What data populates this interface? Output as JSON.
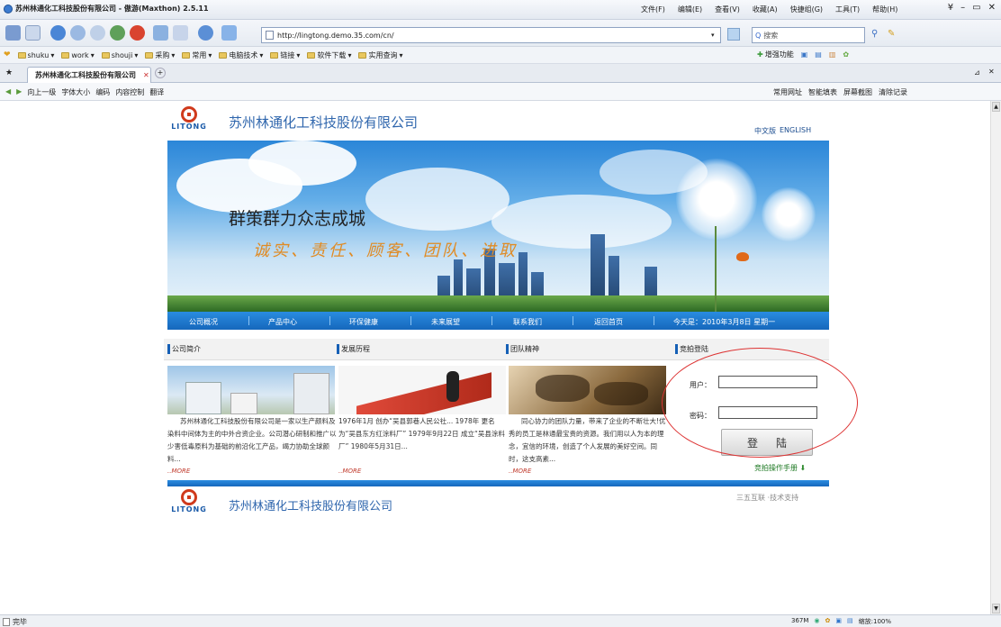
{
  "browser": {
    "window_title": "苏州林通化工科技股份有限公司 - 傲游(Maxthon) 2.5.11",
    "menus": [
      "文件(F)",
      "编辑(E)",
      "查看(V)",
      "收藏(A)",
      "快捷组(G)",
      "工具(T)",
      "帮助(H)"
    ],
    "address": "http://lingtong.demo.35.com/cn/",
    "search_placeholder": "搜索",
    "bookmarks": [
      "shuku",
      "work",
      "shouji",
      "采购",
      "常用",
      "电脑技术",
      "链接",
      "软件下载",
      "实用查询"
    ],
    "bookmark_right": "增强功能",
    "tab_title": "苏州林通化工科技股份有限公司",
    "nav_left": [
      "向上一级",
      "字体大小",
      "编码",
      "内容控制",
      "翻译"
    ],
    "nav_right": [
      "常用网址",
      "智能填表",
      "屏幕截图",
      "清除记录"
    ],
    "status_left": "完毕",
    "status_right": [
      "367M",
      "缩放:100%"
    ]
  },
  "site": {
    "logo_text": "LITONG",
    "company_name": "苏州林通化工科技股份有限公司",
    "lang_cn": "中文版",
    "lang_en": "ENGLISH",
    "slogan_main": "群策群力众志成城",
    "slogan_values": "诚实、责任、顾客、团队、进取",
    "nav_items": [
      "公司概况",
      "产品中心",
      "环保健康",
      "未来展望",
      "联系我们",
      "返回首页"
    ],
    "today": "今天是：2010年3月8日 星期一",
    "sections": [
      {
        "title": "公司简介",
        "text": "苏州林通化工科技股份有限公司是一家以生产颜料及染料中间体为主的中外合资企业。公司潜心研制和推广以少害低毒原料为基础的前沿化工产品，竭力协助全球颜料...",
        "more": "MORE"
      },
      {
        "title": "发展历程",
        "text": "1976年1月 创办“吴县郭巷人民公社... 1978年 更名为“吴县东方红涂料厂” 1979年9月22日 成立“吴县涂料厂” 1980年5月31日...",
        "more": "MORE"
      },
      {
        "title": "团队精神",
        "text": "同心协力的团队力量，带来了企业的不断壮大!优秀的员工是林通最宝贵的资源。我们用以人为本的理念，宜信的环境，创造了个人发展的美好空间。同时，这支高素...",
        "more": "MORE"
      },
      {
        "title": "竞拍登陆"
      }
    ],
    "login": {
      "user_label": "用户：",
      "pass_label": "密码：",
      "user_value": "",
      "pass_value": "",
      "submit": "登陆",
      "manual": "竞拍操作手册"
    },
    "footer_company": "苏州林通化工科技股份有限公司",
    "footer_tech": "三五互联 ·技术支持"
  }
}
